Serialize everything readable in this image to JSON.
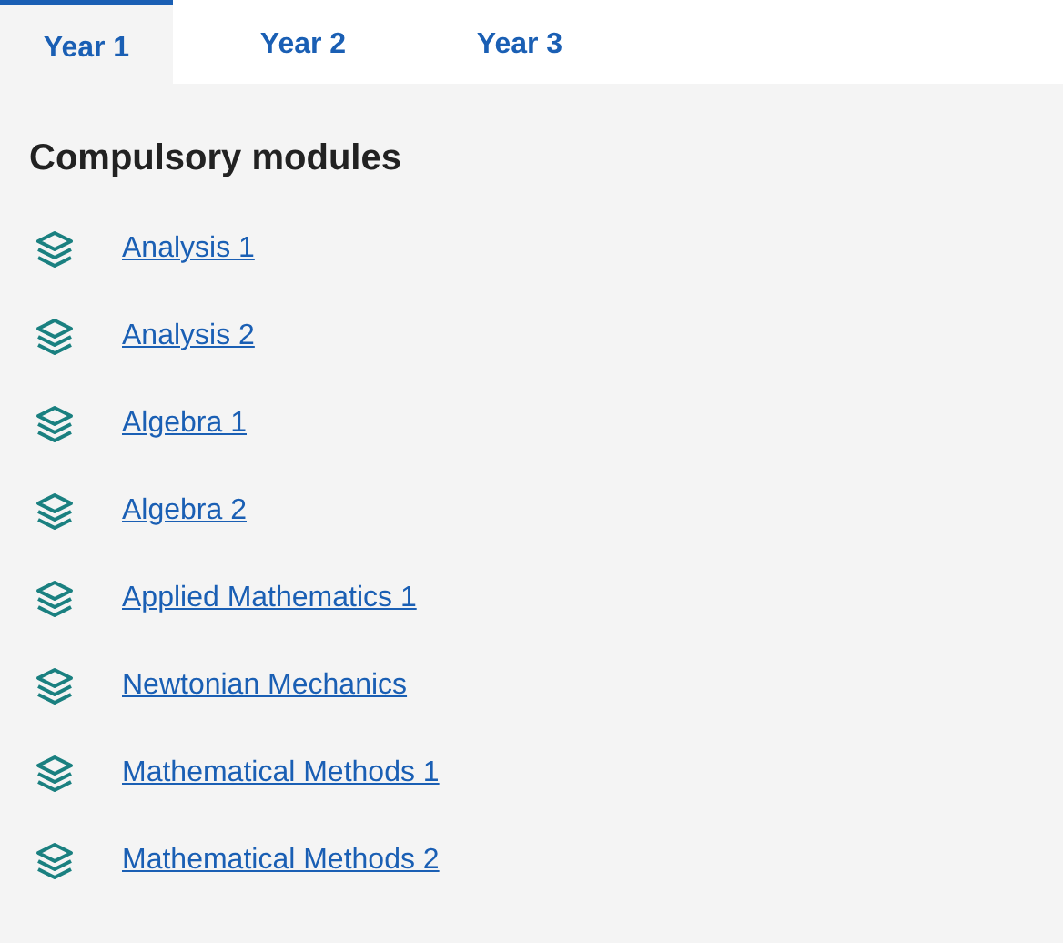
{
  "tabs": [
    {
      "label": "Year 1",
      "selected": true
    },
    {
      "label": "Year 2",
      "selected": false
    },
    {
      "label": "Year 3",
      "selected": false
    }
  ],
  "section": {
    "heading": "Compulsory modules",
    "modules": [
      {
        "name": "Analysis 1"
      },
      {
        "name": "Analysis 2"
      },
      {
        "name": "Algebra 1"
      },
      {
        "name": "Algebra 2"
      },
      {
        "name": "Applied Mathematics 1"
      },
      {
        "name": "Newtonian Mechanics"
      },
      {
        "name": "Mathematical Methods 1"
      },
      {
        "name": "Mathematical Methods 2"
      }
    ]
  }
}
